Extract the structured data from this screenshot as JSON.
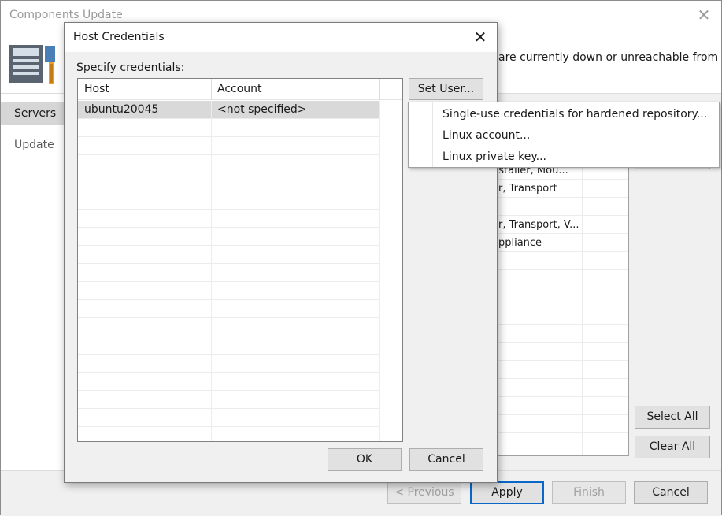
{
  "window": {
    "title": "Components Update",
    "banner_text": "are currently down or unreachable from"
  },
  "nav": {
    "items": [
      {
        "label": "Servers",
        "active": true
      },
      {
        "label": "Update",
        "active": false
      }
    ]
  },
  "background_grid": {
    "rows": [
      {
        "text": "nstaller, Mou..."
      },
      {
        "text": "er, Transport"
      },
      {
        "text": ""
      },
      {
        "text": "er, Transport, V..."
      },
      {
        "text": "appliance"
      }
    ]
  },
  "side_buttons": {
    "select_all": "Select All",
    "clear_all": "Clear All"
  },
  "footer": {
    "previous": "< Previous",
    "apply": "Apply",
    "finish": "Finish",
    "cancel": "Cancel"
  },
  "dialog": {
    "title": "Host Credentials",
    "label": "Specify credentials:",
    "columns": [
      "Host",
      "Account"
    ],
    "rows": [
      {
        "host": "ubuntu20045",
        "account": "<not specified>",
        "selected": true
      }
    ],
    "set_user_label": "Set User...",
    "ok_label": "OK",
    "cancel_label": "Cancel"
  },
  "set_user_menu": {
    "items": [
      "Single-use credentials for hardened repository...",
      "Linux account...",
      "Linux private key..."
    ]
  },
  "colors": {
    "accent": "#0a66c8",
    "selected_row": "#d9d9d9",
    "nav_active": "#d6d6d6"
  },
  "icons": [
    "close-icon",
    "server-tools-icon"
  ]
}
